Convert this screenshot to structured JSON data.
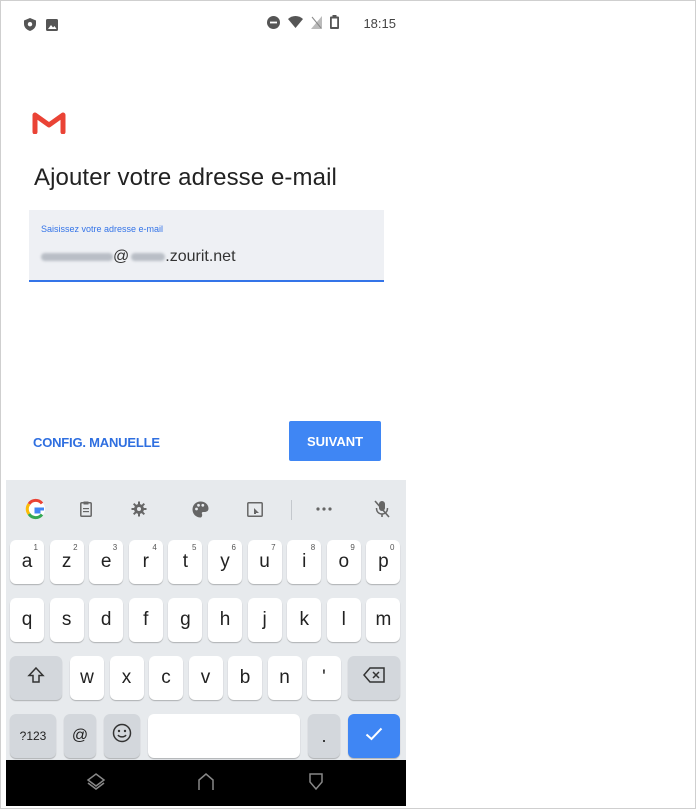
{
  "status_bar": {
    "time": "18:15",
    "left_icons": [
      "shield-icon",
      "image-icon"
    ],
    "right_icons": [
      "dnd-icon",
      "wifi-icon",
      "no-sim-icon",
      "battery-icon"
    ]
  },
  "app": {
    "logo": "gmail-logo",
    "brand_color": "#EA4335",
    "accent_color": "#3F86F4"
  },
  "page": {
    "title": "Ajouter votre adresse e-mail"
  },
  "email_field": {
    "label": "Saisissez votre adresse e-mail",
    "value_visible_suffix": ".zourit.net",
    "value_at": "@"
  },
  "actions": {
    "manual_config": "CONFIG. MANUELLE",
    "next": "SUIVANT"
  },
  "keyboard": {
    "toolbar": [
      "google-icon",
      "clipboard-icon",
      "gear-icon",
      "palette-icon",
      "screen-icon",
      "more-icon",
      "mic-off-icon"
    ],
    "rows": [
      [
        {
          "k": "a",
          "h": "1"
        },
        {
          "k": "z",
          "h": "2"
        },
        {
          "k": "e",
          "h": "3"
        },
        {
          "k": "r",
          "h": "4"
        },
        {
          "k": "t",
          "h": "5"
        },
        {
          "k": "y",
          "h": "6"
        },
        {
          "k": "u",
          "h": "7"
        },
        {
          "k": "i",
          "h": "8"
        },
        {
          "k": "o",
          "h": "9"
        },
        {
          "k": "p",
          "h": "0"
        }
      ],
      [
        {
          "k": "q"
        },
        {
          "k": "s"
        },
        {
          "k": "d"
        },
        {
          "k": "f"
        },
        {
          "k": "g"
        },
        {
          "k": "h"
        },
        {
          "k": "j"
        },
        {
          "k": "k"
        },
        {
          "k": "l"
        },
        {
          "k": "m"
        }
      ],
      [
        {
          "k": "w"
        },
        {
          "k": "x"
        },
        {
          "k": "c"
        },
        {
          "k": "v"
        },
        {
          "k": "b"
        },
        {
          "k": "n"
        },
        {
          "k": "'"
        }
      ]
    ],
    "symbols_label": "?123",
    "at_label": "@",
    "period_label": "."
  }
}
